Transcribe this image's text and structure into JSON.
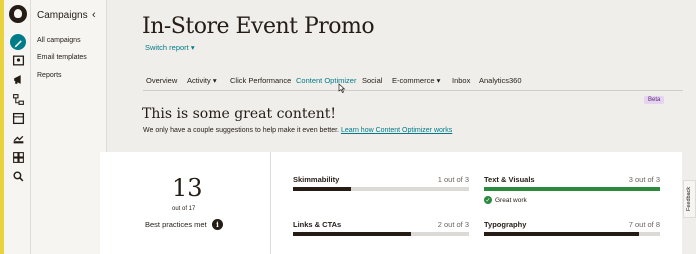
{
  "sidebar": {
    "title": "Campaigns",
    "collapse_icon": "chevron-left-icon",
    "items": [
      {
        "label": "All campaigns"
      },
      {
        "label": "Email templates"
      },
      {
        "label": "Reports"
      }
    ]
  },
  "rail": {
    "icons": [
      "mailchimp-logo",
      "pencil-icon",
      "contacts-icon",
      "megaphone-icon",
      "automations-icon",
      "website-icon",
      "integrations-icon",
      "content-grid-icon",
      "search-icon"
    ]
  },
  "page": {
    "title": "In-Store Event Promo",
    "switch_report": "Switch report"
  },
  "tabs": [
    {
      "label": "Overview"
    },
    {
      "label": "Activity"
    },
    {
      "label": "Click Performance"
    },
    {
      "label": "Content Optimizer"
    },
    {
      "label": "Social"
    },
    {
      "label": "E-commerce"
    },
    {
      "label": "Inbox"
    },
    {
      "label": "Analytics360"
    }
  ],
  "optimizer": {
    "badge": "Beta",
    "heading": "This is some great content!",
    "subtext": "We only have a couple suggestions to help make it even better.",
    "link": "Learn how Content Optimizer works"
  },
  "summary": {
    "score": "13",
    "out_of": "out of 17",
    "label": "Best practices met",
    "info_icon": "i"
  },
  "metrics": [
    {
      "name": "Skimmability",
      "score": "1 out of 3",
      "fraction": 0.33,
      "color": "#241c15"
    },
    {
      "name": "Text & Visuals",
      "score": "3 out of 3",
      "fraction": 1.0,
      "color": "#2c8a3f",
      "note": "Great work"
    },
    {
      "name": "Links & CTAs",
      "score": "2 out of 3",
      "fraction": 0.67,
      "color": "#241c15"
    },
    {
      "name": "Typography",
      "score": "7 out of 8",
      "fraction": 0.88,
      "color": "#241c15"
    }
  ],
  "feedback": "Feedback",
  "colors": {
    "accent": "#007c89",
    "success": "#2c8a3f",
    "brand_yellow": "#e8d33f"
  }
}
